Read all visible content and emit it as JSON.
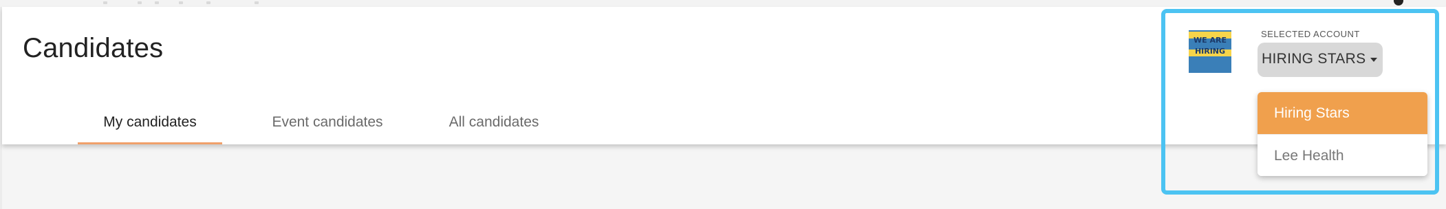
{
  "page": {
    "title": "Candidates"
  },
  "tabs": [
    {
      "label": "My candidates",
      "active": true
    },
    {
      "label": "Event candidates",
      "active": false
    },
    {
      "label": "All candidates",
      "active": false
    }
  ],
  "account": {
    "label": "SELECTED ACCOUNT",
    "selected": "HIRING STARS",
    "logo_text": [
      "WE ARE",
      "HIRING"
    ],
    "options": [
      "Hiring Stars",
      "Lee Health"
    ]
  },
  "colors": {
    "accent_orange": "#f0a04d",
    "tab_underline": "#f0a06a",
    "highlight_border": "#4cc3f2",
    "select_bg": "#d8d8d8",
    "content_bg": "#f5f5f5"
  },
  "icons": {
    "caret": "caret-down-icon",
    "logo": "we-are-hiring-logo"
  }
}
